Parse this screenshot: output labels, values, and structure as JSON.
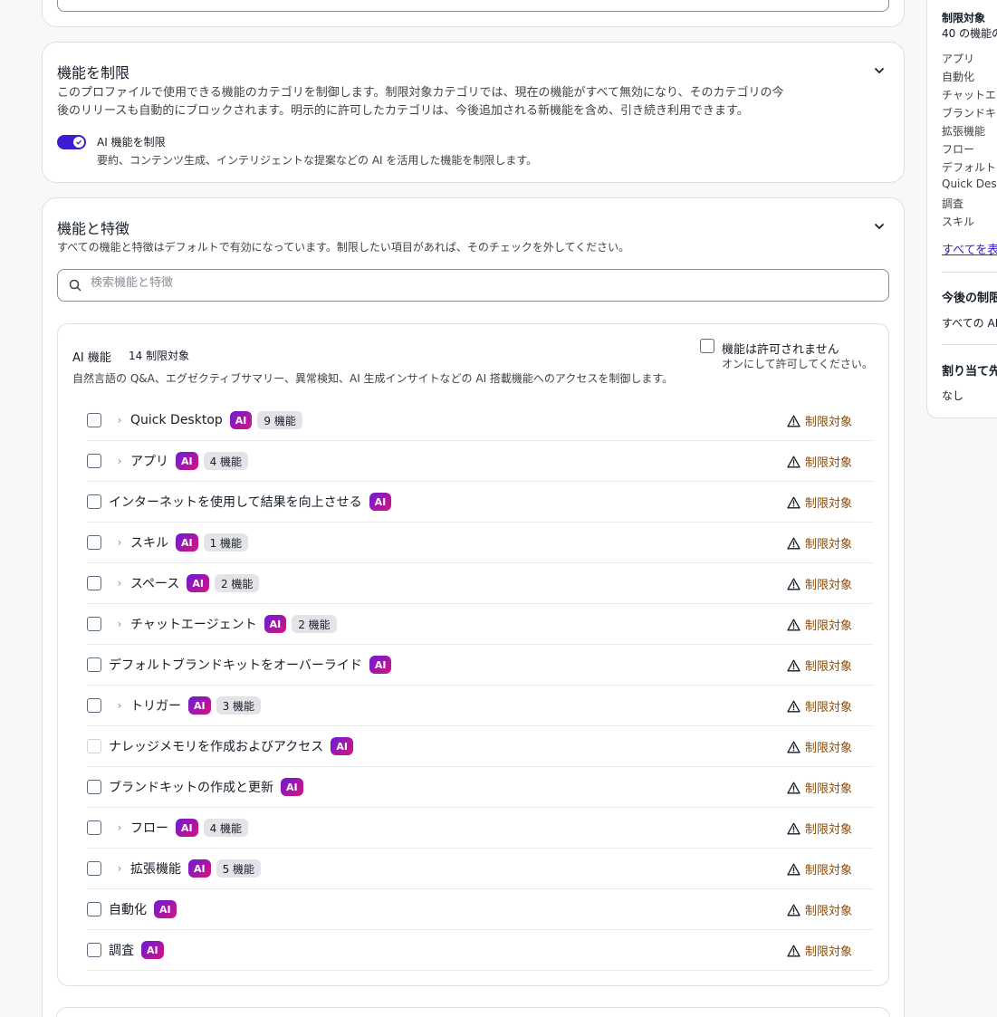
{
  "restrict": {
    "title": "機能を制限",
    "description_line1": "このプロファイルで使用できる機能のカテゴリを制御します。制限対象カテゴリでは、現在の機能がすべて無効になり、そのカテゴリの今",
    "description_line2": "後のリリースも自動的にブロックされます。明示的に許可したカテゴリは、今後追加される新機能を含め、引き続き利用できます。",
    "toggle_label": "AI 機能を制限",
    "toggle_description": "要約、コンテンツ生成、インテリジェントな提案などの AI を活用した機能を制限します。",
    "toggle_on": true
  },
  "features": {
    "title": "機能と特徴",
    "description": "すべての機能と特徴はデフォルトで有効になっています。制限したい項目があれば、そのチェックを外してください。",
    "search_placeholder": "検索機能と特徴",
    "group": {
      "title": "AI 機能",
      "count": "14 制限対象",
      "description": "自然言語の Q&A、エグゼクティブサマリー、異常検知、AI 生成インサイトなどの AI 搭載機能へのアクセスを制御します。",
      "allow_title": "機能は許可されません",
      "allow_description": "オンにして許可してください。",
      "ai_badge": "AI",
      "status_label": "制限対象",
      "rows": [
        {
          "label": "Quick Desktop",
          "expandable": true,
          "count": "9 機能"
        },
        {
          "label": "アプリ",
          "expandable": true,
          "count": "4 機能"
        },
        {
          "label": "インターネットを使用して結果を向上させる",
          "expandable": false,
          "count": ""
        },
        {
          "label": "スキル",
          "expandable": true,
          "count": "1 機能"
        },
        {
          "label": "スペース",
          "expandable": true,
          "count": "2 機能"
        },
        {
          "label": "チャットエージェント",
          "expandable": true,
          "count": "2 機能"
        },
        {
          "label": "デフォルトブランドキットをオーバーライド",
          "expandable": false,
          "count": ""
        },
        {
          "label": "トリガー",
          "expandable": true,
          "count": "3 機能"
        },
        {
          "label": "ナレッジメモリを作成およびアクセス",
          "expandable": false,
          "count": "",
          "disabled": true
        },
        {
          "label": "ブランドキットの作成と更新",
          "expandable": false,
          "count": ""
        },
        {
          "label": "フロー",
          "expandable": true,
          "count": "4 機能"
        },
        {
          "label": "拡張機能",
          "expandable": true,
          "count": "5 機能"
        },
        {
          "label": "自動化",
          "expandable": false,
          "count": ""
        },
        {
          "label": "調査",
          "expandable": false,
          "count": ""
        }
      ]
    }
  },
  "sidebar": {
    "restricted_title": "制限対象",
    "restricted_subtitle": "40 の機能の",
    "items": [
      "アプリ",
      "自動化",
      "チャットエ",
      "ブランドキ",
      "拡張機能",
      "フロー",
      "デフォルト",
      "Quick Desk",
      "調査",
      "スキル"
    ],
    "show_all": "すべてを表",
    "future_title": "今後の制限",
    "future_value": "すべての AI",
    "assign_title": "割り当て先",
    "assign_value": "なし"
  },
  "colors": {
    "accent": "#3e1ccf",
    "warning": "#8a4b08"
  }
}
